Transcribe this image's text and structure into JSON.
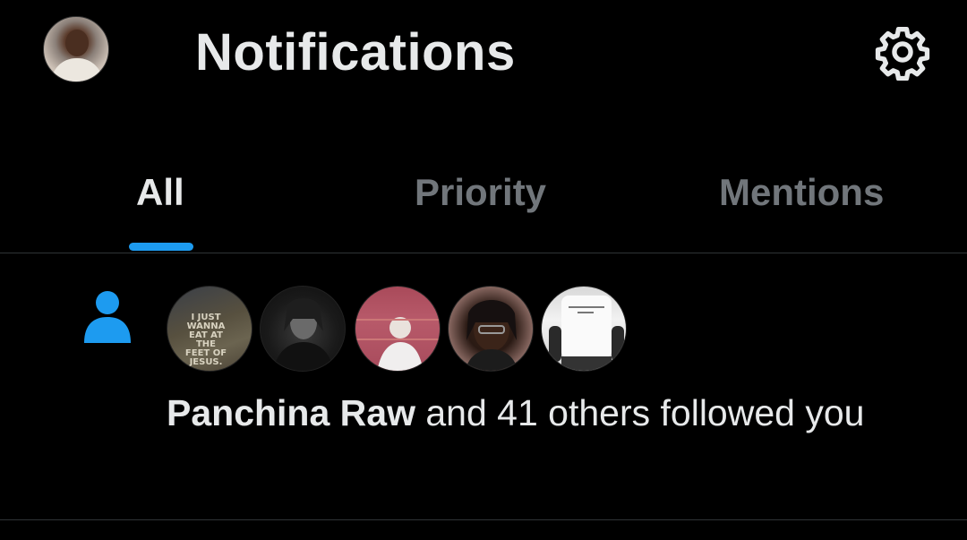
{
  "header": {
    "title": "Notifications",
    "settings_icon": "gear-icon"
  },
  "tabs": [
    {
      "label": "All",
      "active": true
    },
    {
      "label": "Priority",
      "active": false
    },
    {
      "label": "Mentions",
      "active": false
    }
  ],
  "notification": {
    "icon": "person-icon",
    "name": "Panchina Raw",
    "text": " and 41 others followed you",
    "avatars": [
      {
        "shirt_text": "I JUST WANNA EAT AT THE FEET OF JESUS."
      },
      {},
      {},
      {},
      {}
    ]
  },
  "colors": {
    "background": "#000000",
    "accent": "#1d9bf0",
    "primary_text": "#e7e9ea",
    "secondary_text": "#71767b",
    "divider": "#2f3336"
  }
}
